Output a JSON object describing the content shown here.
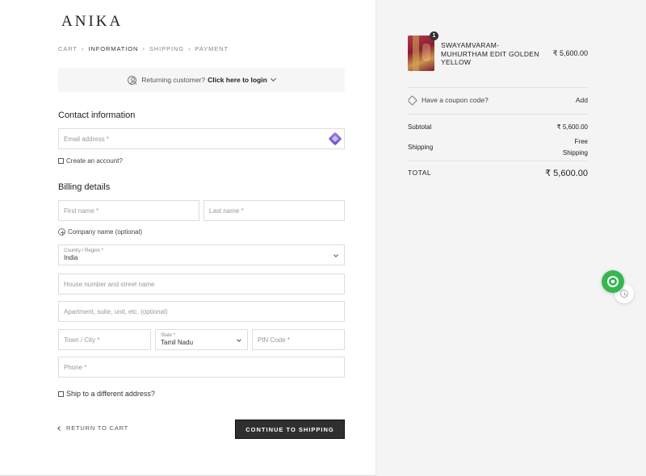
{
  "brand": {
    "logo": "ANIKA"
  },
  "breadcrumb": [
    {
      "label": "CART"
    },
    {
      "label": "INFORMATION"
    },
    {
      "label": "SHIPPING"
    },
    {
      "label": "PAYMENT"
    }
  ],
  "returning": {
    "text": "Returning customer?",
    "link": "Click here to login"
  },
  "contact": {
    "title": "Contact information",
    "email_placeholder": "Email address *",
    "create_account_label": "Create an account?"
  },
  "billing": {
    "title": "Billing details",
    "first_name_placeholder": "First name *",
    "last_name_placeholder": "Last name *",
    "company_label": "Company name (optional)",
    "country_label": "Country / Region *",
    "country_value": "India",
    "street_placeholder": "House number and street name",
    "apartment_placeholder": "Apartment, suite, unit, etc. (optional)",
    "city_placeholder": "Town / City *",
    "state_label": "State *",
    "state_value": "Tamil Nadu",
    "pin_placeholder": "PIN Code *",
    "phone_placeholder": "Phone *",
    "ship_different_label": "Ship to a different address?"
  },
  "actions": {
    "return_label": "RETURN TO CART",
    "continue_label": "CONTINUE TO SHIPPING"
  },
  "summary": {
    "product": {
      "name": "SWAYAMVARAM-MUHURTHAM EDIT GOLDEN YELLOW",
      "price": "₹ 5,600.00",
      "quantity": "1"
    },
    "coupon": {
      "text": "Have a coupon code?",
      "add_label": "Add"
    },
    "subtotal": {
      "label": "Subtotal",
      "value": "₹ 5,600.00"
    },
    "shipping": {
      "label": "Shipping",
      "value_line1": "Free",
      "value_line2": "Shipping"
    },
    "total": {
      "label": "TOTAL",
      "value": "₹ 5,600.00"
    }
  },
  "colors": {
    "summary_bg": "#f4f4f4",
    "button_bg": "#2f2f2f",
    "whatsapp": "#35b750"
  },
  "icons": [
    "user-icon",
    "chevron-down-icon",
    "password-manager-icon",
    "plus-circle-icon",
    "tag-icon",
    "whatsapp-icon",
    "history-icon",
    "arrow-left-icon"
  ]
}
